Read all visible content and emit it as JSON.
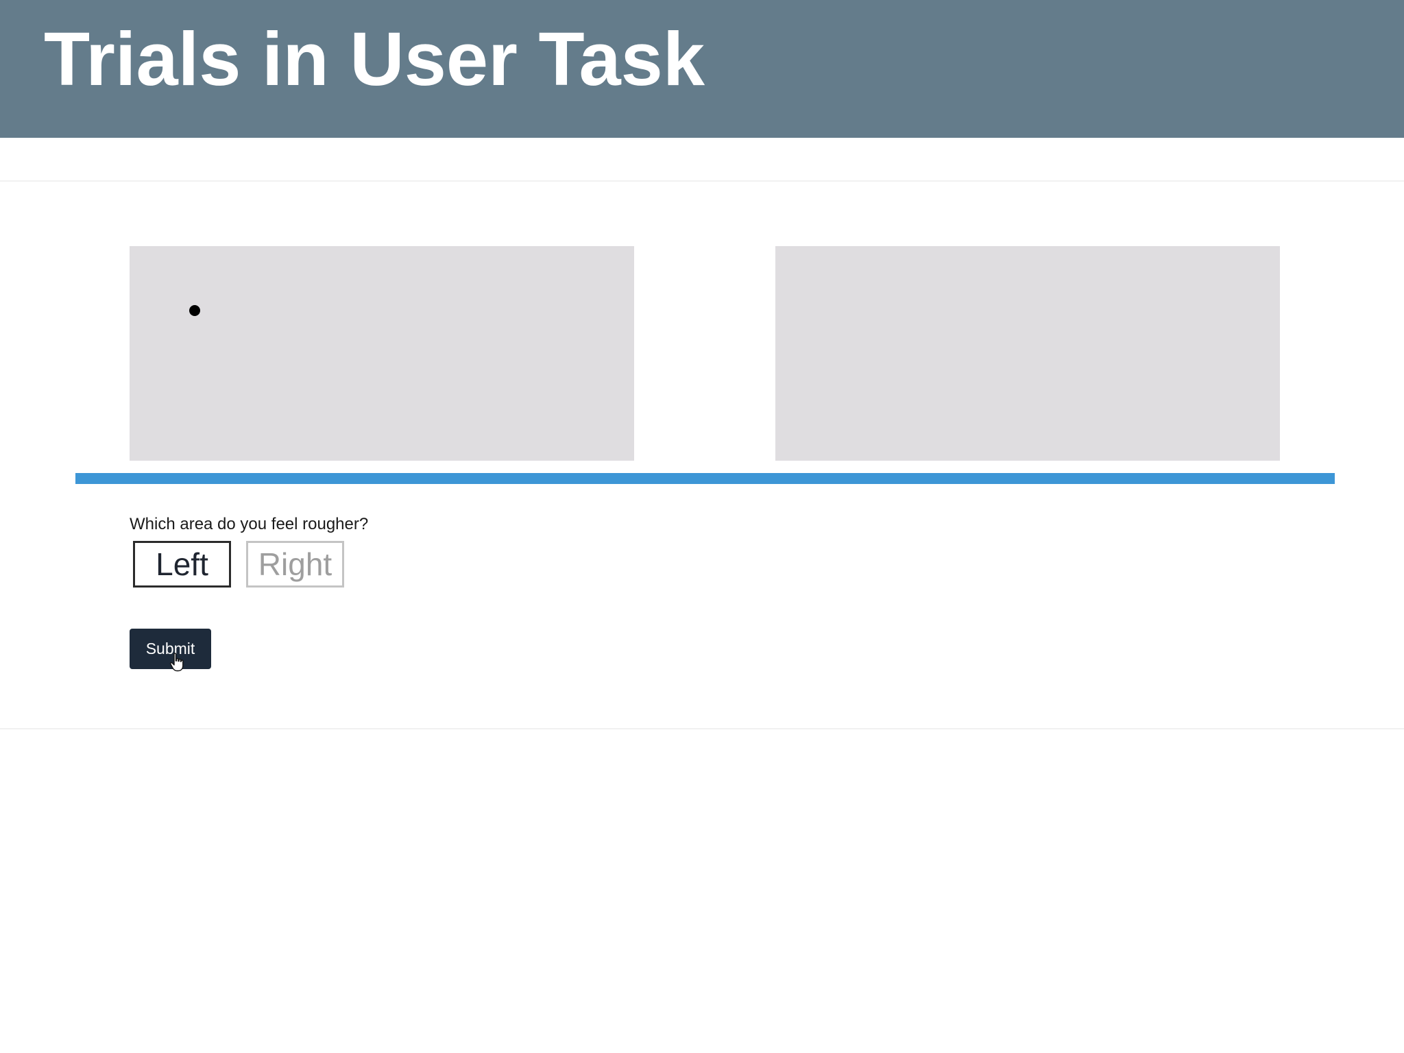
{
  "header": {
    "title": "Trials in User Task"
  },
  "question": {
    "text": "Which area do you feel rougher?"
  },
  "choices": [
    {
      "label": "Left",
      "selected": true
    },
    {
      "label": "Right",
      "selected": false
    }
  ],
  "submit": {
    "label": "Submit"
  },
  "colors": {
    "header_bg": "#647c8b",
    "panel_bg": "#dfdde0",
    "progress_bar": "#3d96d6",
    "submit_bg": "#1e2b3b"
  },
  "icons": {
    "dot": "stimulus-dot-icon",
    "cursor": "hand-pointer-icon"
  }
}
